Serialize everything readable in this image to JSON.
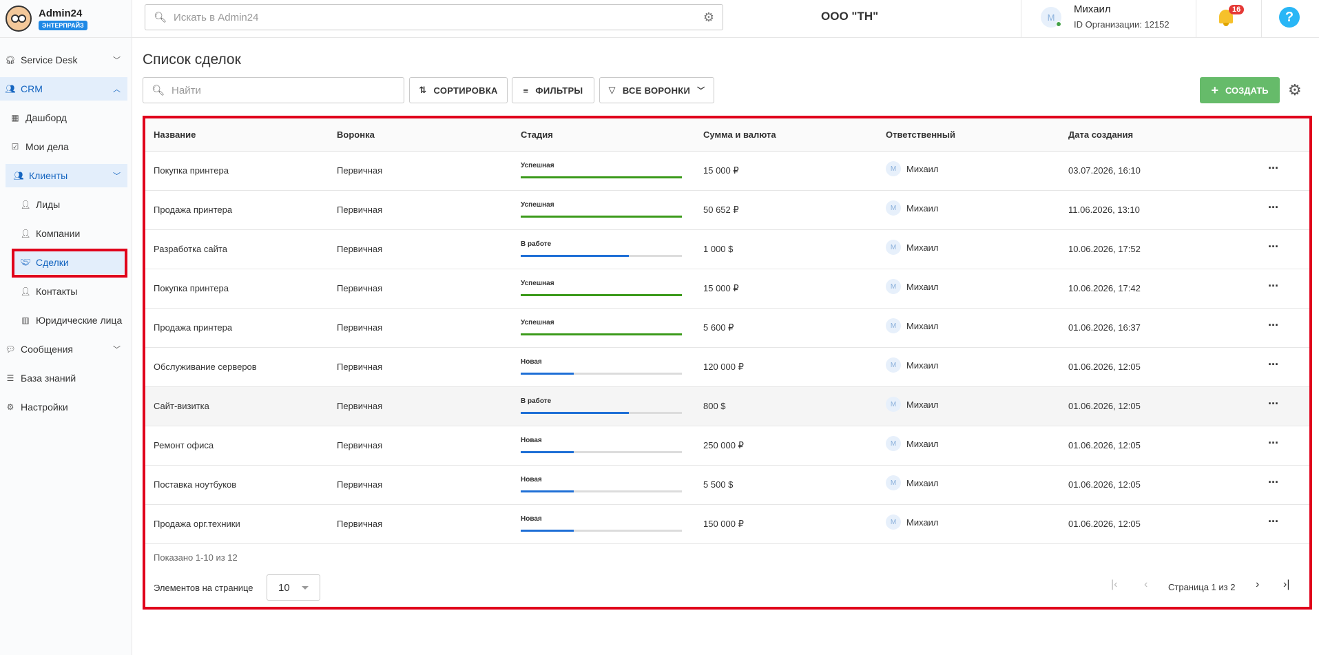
{
  "app": {
    "brand": "Admin24",
    "edition": "ЭНТЕРПРАЙЗ"
  },
  "sidebar": {
    "items": [
      {
        "label": "Service Desk",
        "icon": "headset-icon"
      },
      {
        "label": "CRM",
        "icon": "users-icon"
      },
      {
        "label": "Дашборд",
        "icon": "dashboard-icon"
      },
      {
        "label": "Мои дела",
        "icon": "calendar-check-icon"
      },
      {
        "label": "Клиенты",
        "icon": "users-icon"
      },
      {
        "label": "Лиды",
        "icon": "person-icon"
      },
      {
        "label": "Компании",
        "icon": "person-icon"
      },
      {
        "label": "Сделки",
        "icon": "handshake-icon"
      },
      {
        "label": "Контакты",
        "icon": "person-icon"
      },
      {
        "label": "Юридические лица",
        "icon": "building-icon"
      },
      {
        "label": "Сообщения",
        "icon": "chat-icon"
      },
      {
        "label": "База знаний",
        "icon": "database-icon"
      },
      {
        "label": "Настройки",
        "icon": "gear-icon"
      }
    ]
  },
  "header": {
    "search_placeholder": "Искать в Admin24",
    "org_name": "ООО \"ТН\"",
    "user_initial": "M",
    "user_name": "Михаил",
    "org_id": "ID Организации: 12152",
    "notifications": "16",
    "help": "?"
  },
  "main": {
    "title": "Список сделок",
    "search_placeholder": "Найти",
    "sort_label": "СОРТИРОВКА",
    "filters_label": "ФИЛЬТРЫ",
    "funnels_label": "ВСЕ ВОРОНКИ",
    "create_label": "СОЗДАТЬ"
  },
  "table": {
    "columns": [
      "Название",
      "Воронка",
      "Стадия",
      "Сумма и валюта",
      "Ответственный",
      "Дата создания"
    ],
    "rows": [
      {
        "name": "Покупка принтера",
        "funnel": "Первичная",
        "stage": "Успешная",
        "progress": 1.0,
        "amount": "15 000 ₽",
        "resp_initial": "M",
        "resp": "Михаил",
        "date": "03.07.2026, 16:10"
      },
      {
        "name": "Продажа принтера",
        "funnel": "Первичная",
        "stage": "Успешная",
        "progress": 1.0,
        "amount": "50 652 ₽",
        "resp_initial": "M",
        "resp": "Михаил",
        "date": "11.06.2026, 13:10"
      },
      {
        "name": "Разработка сайта",
        "funnel": "Первичная",
        "stage": "В работе",
        "progress": 0.67,
        "amount": "1 000 $",
        "resp_initial": "M",
        "resp": "Михаил",
        "date": "10.06.2026, 17:52"
      },
      {
        "name": "Покупка принтера",
        "funnel": "Первичная",
        "stage": "Успешная",
        "progress": 1.0,
        "amount": "15 000 ₽",
        "resp_initial": "M",
        "resp": "Михаил",
        "date": "10.06.2026, 17:42"
      },
      {
        "name": "Продажа принтера",
        "funnel": "Первичная",
        "stage": "Успешная",
        "progress": 1.0,
        "amount": "5 600 ₽",
        "resp_initial": "M",
        "resp": "Михаил",
        "date": "01.06.2026, 16:37"
      },
      {
        "name": "Обслуживание серверов",
        "funnel": "Первичная",
        "stage": "Новая",
        "progress": 0.33,
        "amount": "120 000 ₽",
        "resp_initial": "M",
        "resp": "Михаил",
        "date": "01.06.2026, 12:05"
      },
      {
        "name": "Сайт-визитка",
        "funnel": "Первичная",
        "stage": "В работе",
        "progress": 0.67,
        "amount": "800 $",
        "resp_initial": "M",
        "resp": "Михаил",
        "date": "01.06.2026, 12:05"
      },
      {
        "name": "Ремонт офиса",
        "funnel": "Первичная",
        "stage": "Новая",
        "progress": 0.33,
        "amount": "250 000 ₽",
        "resp_initial": "M",
        "resp": "Михаил",
        "date": "01.06.2026, 12:05"
      },
      {
        "name": "Поставка ноутбуков",
        "funnel": "Первичная",
        "stage": "Новая",
        "progress": 0.33,
        "amount": "5 500 $",
        "resp_initial": "M",
        "resp": "Михаил",
        "date": "01.06.2026, 12:05"
      },
      {
        "name": "Продажа орг.техники",
        "funnel": "Первичная",
        "stage": "Новая",
        "progress": 0.33,
        "amount": "150 000 ₽",
        "resp_initial": "M",
        "resp": "Михаил",
        "date": "01.06.2026, 12:05"
      }
    ],
    "stage_colors": {
      "success": "#3b9a1a",
      "progress": "#1e6fd6"
    }
  },
  "pagination": {
    "shown": "Показано 1-10 из 12",
    "per_page_label": "Элементов на странице",
    "per_page_value": "10",
    "page_text": "Страница 1 из 2"
  }
}
